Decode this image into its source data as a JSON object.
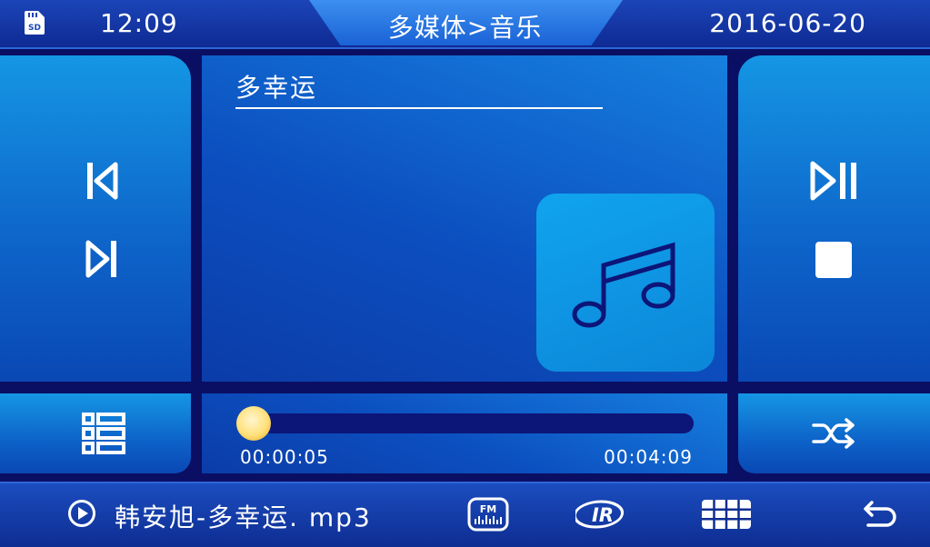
{
  "status": {
    "storage_icon": "sd-card-icon",
    "time": "12:09",
    "title": "多媒体>音乐",
    "date": "2016-06-20"
  },
  "player": {
    "song_title": "多幸运",
    "file_name": "韩安旭-多幸运. mp3",
    "current_time": "00:00:05",
    "total_time": "00:04:09",
    "progress": 0.02
  },
  "controls": {
    "prev": "skip-previous-icon",
    "next": "skip-next-icon",
    "play_pause": "play-pause-icon",
    "stop": "stop-icon",
    "playlist": "playlist-icon",
    "shuffle": "shuffle-icon",
    "album_art": "music-note-icon"
  },
  "bottom_bar": {
    "play_indicator": "play-circle-icon",
    "fm_icon_label": "FM",
    "ir_icon_label": "IR",
    "keypad": "keypad-icon",
    "back": "back-icon"
  },
  "colors": {
    "background": "#0a0f63",
    "panel": "#0d62c8",
    "knob": "#ffe07a"
  }
}
